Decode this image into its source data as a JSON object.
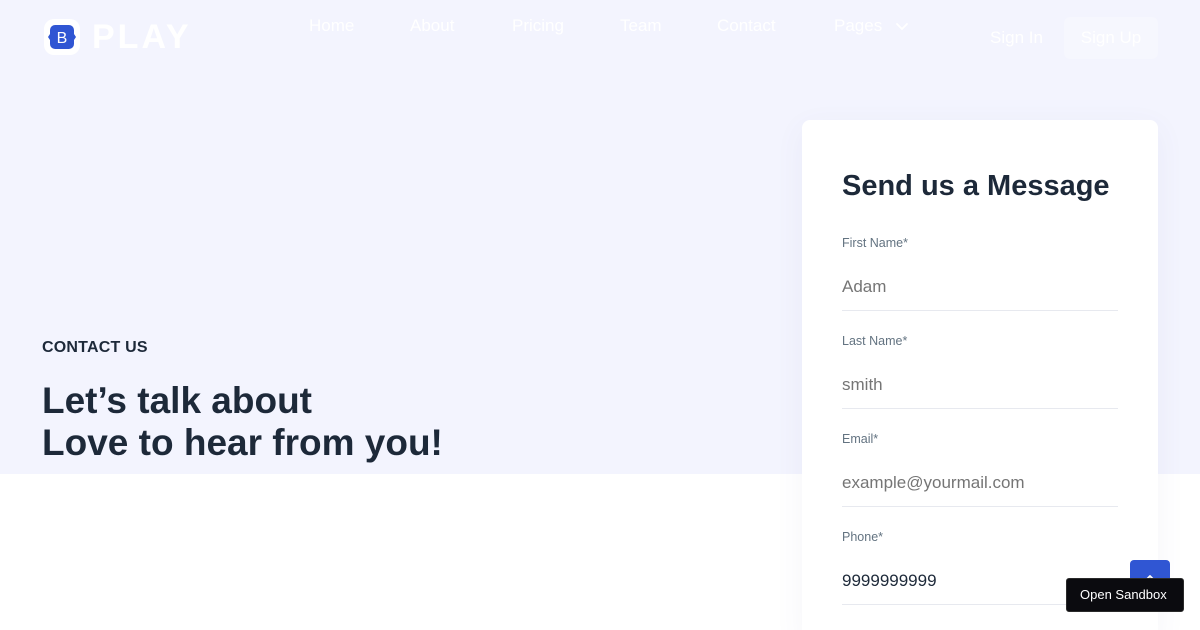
{
  "brand": {
    "letter": "B",
    "name": "PLAY"
  },
  "colors": {
    "primary": "#3056d3",
    "hero_bg": "#f3f4fe",
    "heading": "#1d2939",
    "muted": "#637381"
  },
  "nav": {
    "items": [
      "Home",
      "About",
      "Pricing",
      "Team",
      "Contact",
      "Pages"
    ],
    "pages_icon": "chevron-down-icon"
  },
  "auth": {
    "sign_in": "Sign In",
    "sign_up": "Sign Up"
  },
  "hero": {
    "eyebrow": "CONTACT US",
    "line1": "Let’s talk about",
    "line2": "Love to hear from you!"
  },
  "form": {
    "title": "Send us a Message",
    "fields": [
      {
        "label": "First Name*",
        "placeholder": "Adam",
        "value": ""
      },
      {
        "label": "Last Name*",
        "placeholder": "smith",
        "value": ""
      },
      {
        "label": "Email*",
        "placeholder": "example@yourmail.com",
        "value": ""
      },
      {
        "label": "Phone*",
        "placeholder": "",
        "value": "9999999999"
      }
    ]
  },
  "floating": {
    "sandbox_label": "Open Sandbox",
    "scroll_icon": "arrow-up-icon"
  }
}
